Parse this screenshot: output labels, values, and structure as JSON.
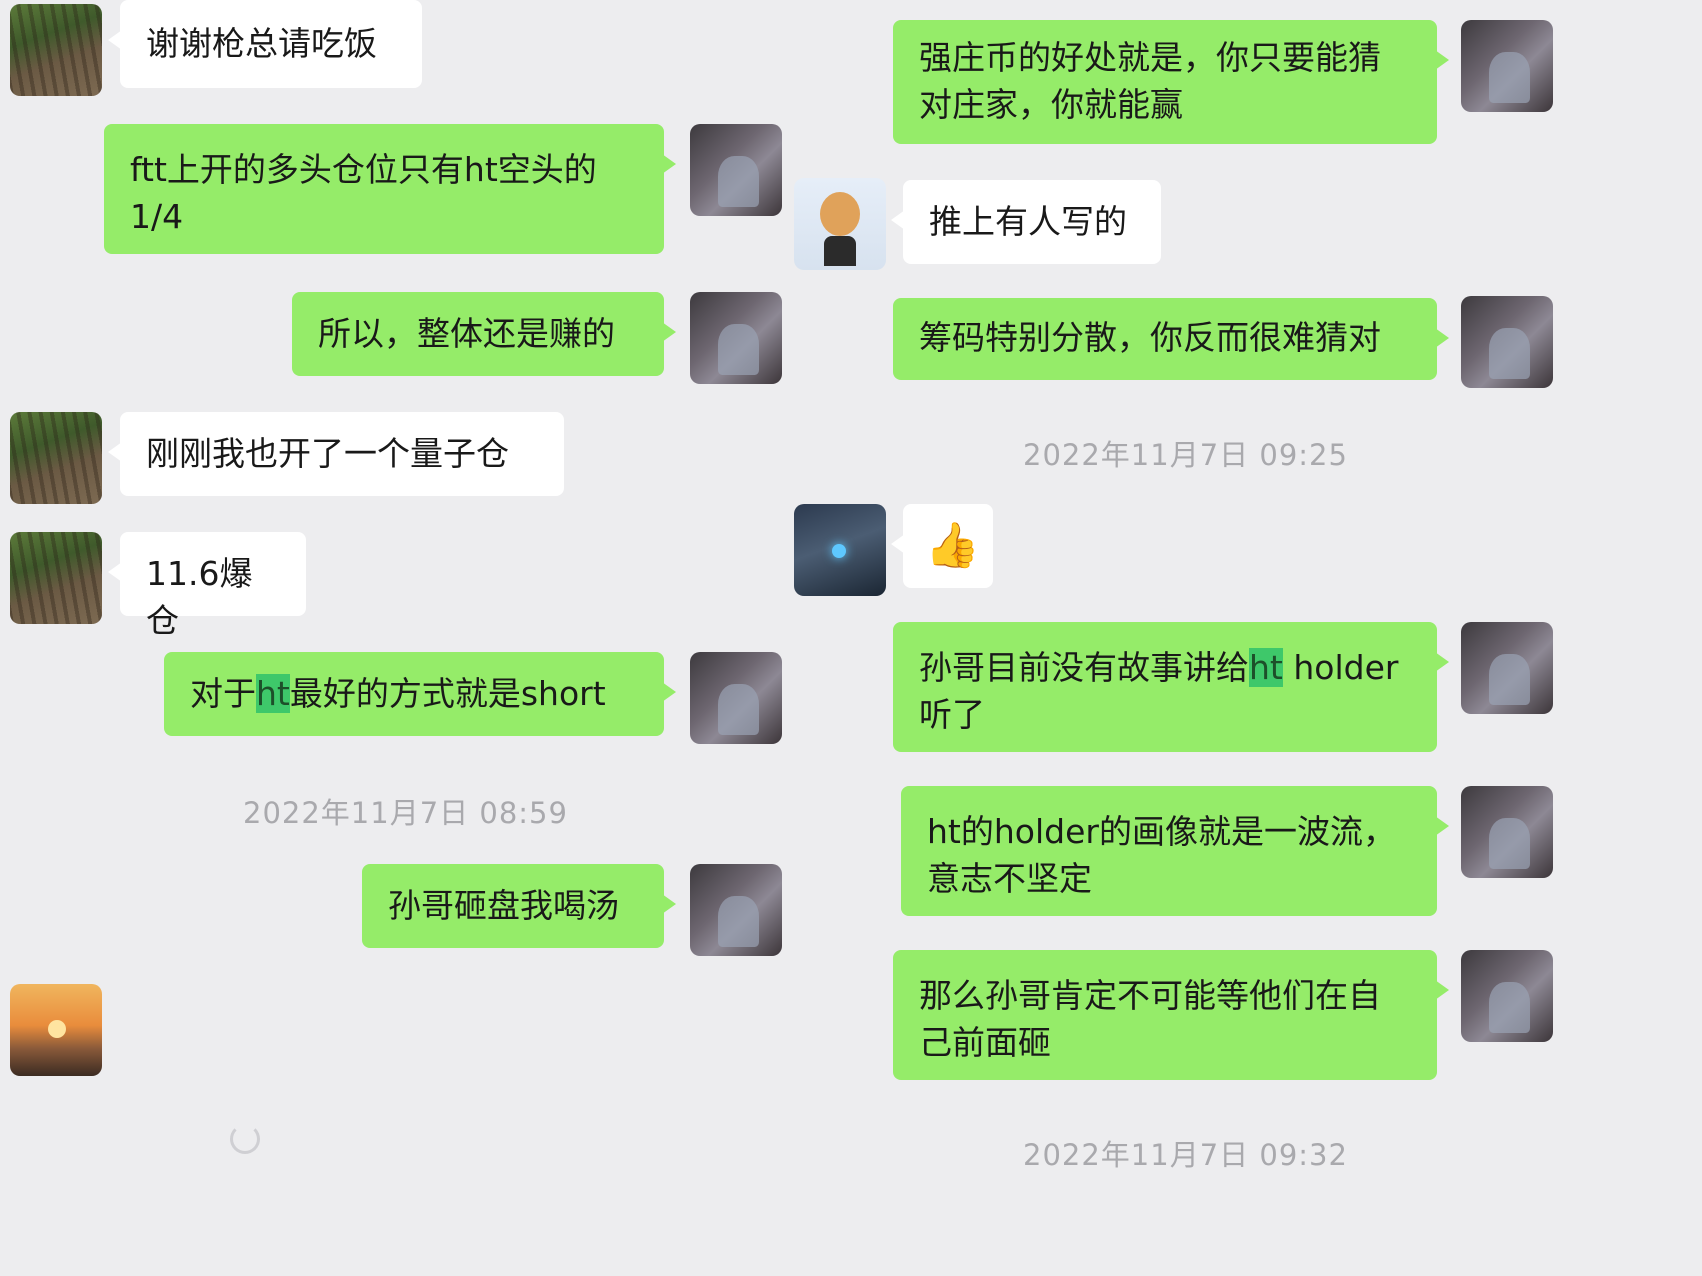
{
  "left": {
    "messages": [
      {
        "text": "谢谢枪总请吃饭"
      },
      {
        "text": "ftt上开的多头仓位只有ht空头的\n1/4"
      },
      {
        "text": "所以，整体还是赚的"
      },
      {
        "text": "刚刚我也开了一个量子仓"
      },
      {
        "text": "11.6爆仓"
      },
      {
        "pre": "对于",
        "hl": "ht",
        "post": "最好的方式就是short"
      },
      {
        "text": "孙哥砸盘我喝汤"
      }
    ],
    "timestamp": "2022年11月7日 08:59"
  },
  "right": {
    "messages": [
      {
        "text": "强庄币的好处就是，你只要能猜\n对庄家，你就能赢"
      },
      {
        "text": "推上有人写的"
      },
      {
        "text": "筹码特别分散，你反而很难猜对"
      },
      {
        "emoji": "👍"
      },
      {
        "pre": "孙哥目前没有故事讲给",
        "hl": "ht",
        "post": " holder\n听了"
      },
      {
        "text": "ht的holder的画像就是一波流，\n意志不坚定"
      },
      {
        "text": "那么孙哥肯定不可能等他们在自\n己前面砸"
      }
    ],
    "timestamp_1": "2022年11月7日 09:25",
    "timestamp_2": "2022年11月7日 09:32"
  }
}
